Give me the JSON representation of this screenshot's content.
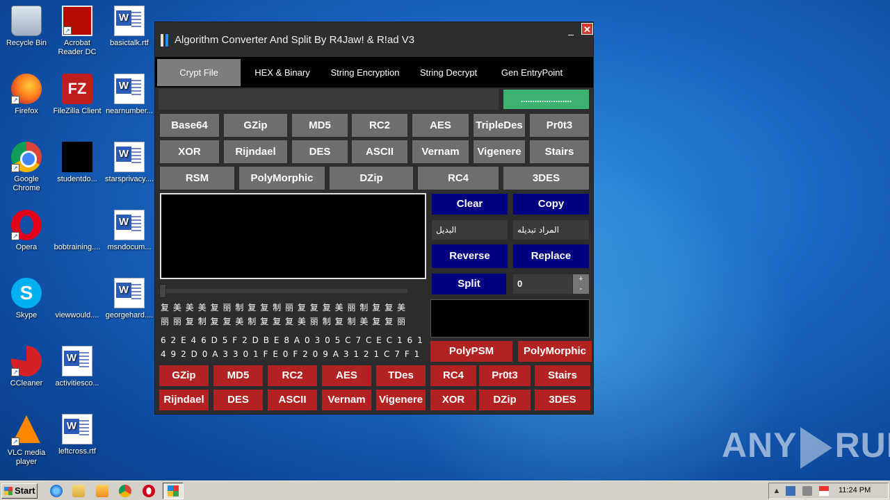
{
  "desktop": {
    "icons": [
      {
        "label": "Recycle Bin"
      },
      {
        "label": "Acrobat Reader DC"
      },
      {
        "label": "basictalk.rtf"
      },
      {
        "label": "Firefox"
      },
      {
        "label": "FileZilla Client"
      },
      {
        "label": "nearnumber..."
      },
      {
        "label": "Google Chrome"
      },
      {
        "label": "studentdo..."
      },
      {
        "label": "starsprivacy...."
      },
      {
        "label": "Opera"
      },
      {
        "label": "bobtraining...."
      },
      {
        "label": "msndocum..."
      },
      {
        "label": "Skype"
      },
      {
        "label": "viewwould...."
      },
      {
        "label": "georgehard...."
      },
      {
        "label": "CCleaner"
      },
      {
        "label": "activitiesco..."
      },
      {
        "label": "VLC media player"
      },
      {
        "label": "leftcross.rtf"
      }
    ],
    "fz_glyph": "FZ",
    "skype_glyph": "S",
    "shortcut_glyph": "↗"
  },
  "window": {
    "title": "Algorithm Converter And Split By R4Jaw! & R!ad V3",
    "minimize": "_",
    "close": "✕",
    "tabs": [
      {
        "label": "Crypt File",
        "active": true
      },
      {
        "label": "HEX & Binary"
      },
      {
        "label": "String Encryption"
      },
      {
        "label": "String Decrypt"
      },
      {
        "label": "Gen EntryPoint"
      }
    ],
    "path_value": "",
    "browse_label": "......................",
    "algo_row1": [
      "Base64",
      "GZip",
      "MD5",
      "RC2",
      "AES",
      "TripleDes",
      "Pr0t3"
    ],
    "algo_row2": [
      "XOR",
      "Rijndael",
      "DES",
      "ASCII",
      "Vernam",
      "Vigenere",
      "Stairs"
    ],
    "algo_row3": [
      "RSM",
      "PolyMorphic",
      "DZip",
      "RC4",
      "3DES"
    ],
    "editor_text": "",
    "cjk_line1": "复美美美复丽制复复制丽复复复美丽制复复美",
    "cjk_line2": "丽丽复制复复美制复复复美丽制复制美复复丽",
    "hex_line1": "62E46D5F2DBE8A0305C7CEC161",
    "hex_line2": "492D0A3301FE0F209A3121C7F1",
    "clear_label": "Clear",
    "copy_label": "Copy",
    "find_value": "البديل",
    "replace_value": "المراد تبديله",
    "reverse_label": "Reverse",
    "replace_label": "Replace",
    "split_label": "Split",
    "split_count": "0",
    "spin_up": "+",
    "spin_down": "-",
    "output_text": "",
    "poly_psm": "PolyPSM",
    "poly_morphic": "PolyMorphic",
    "red_row1": [
      "GZip",
      "MD5",
      "RC2",
      "AES",
      "TDes",
      "RC4",
      "Pr0t3",
      "Stairs"
    ],
    "red_row2": [
      "Rijndael",
      "DES",
      "ASCII",
      "Vernam",
      "Vigenere",
      "XOR",
      "DZip",
      "3DES"
    ]
  },
  "watermark": {
    "left": "ANY",
    "right": "RUN"
  },
  "taskbar": {
    "start_label": "Start",
    "clock": "11:24 PM",
    "tray_up": "▲"
  },
  "colors": {
    "window_bg": "#2d2d30",
    "tab_active": "#7d7d7d",
    "gray_button": "#6e6e6e",
    "navy_button": "#000080",
    "red_button": "#b22222",
    "browse_green": "#3cb371",
    "close_red": "#d23a2c"
  }
}
